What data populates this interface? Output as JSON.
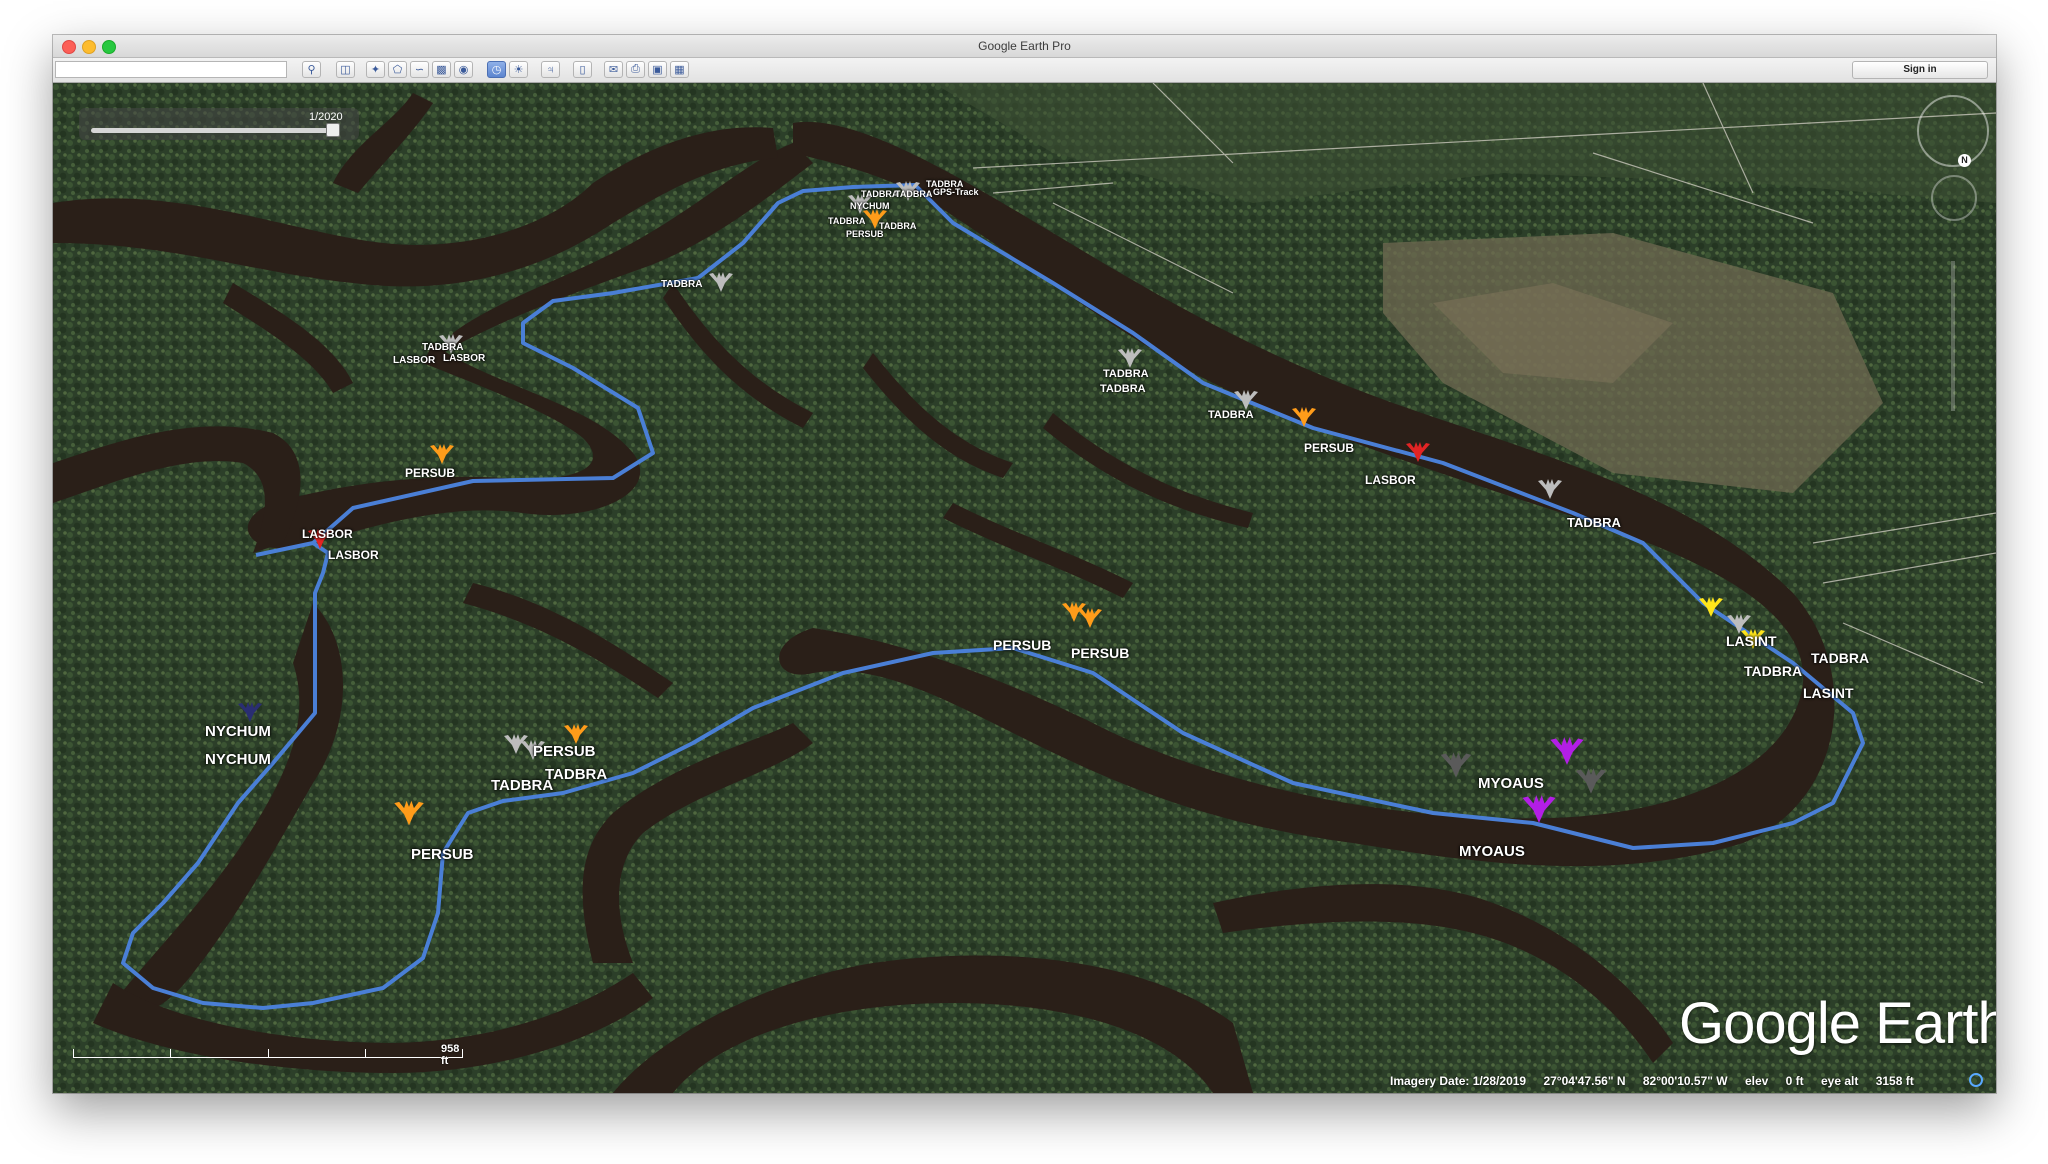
{
  "window": {
    "title": "Google Earth Pro"
  },
  "toolbar": {
    "search_value": "",
    "sign_in": "Sign in"
  },
  "time_slider": {
    "label": "1/2020"
  },
  "scale": {
    "label": "958 ft"
  },
  "compass": {
    "north_label": "N"
  },
  "logo": "Google Earth",
  "status": {
    "imagery_date": "Imagery Date: 1/28/2019",
    "latitude": "27°04'47.56\" N",
    "longitude": "82°00'10.57\" W",
    "elev": "elev",
    "elev_value": "0 ft",
    "eye_alt": "eye alt",
    "eye_alt_value": "3158 ft"
  },
  "colors": {
    "track": "#4a7fd6",
    "TADBRA": "#bdbdbd",
    "PERSUB": "#ff9c1a",
    "LASBOR": "#e32424",
    "NYCHUM": "#2a2e72",
    "MYOAUS": "#b31ee6",
    "LASINT": "#ffe51a"
  },
  "labels": {
    "gps": "GPS-Track",
    "t1": "TADBRA",
    "t2": "TADBRA",
    "t3": "TADBRA",
    "t4": "NYCHUM",
    "t5": "TADBRA",
    "t6": "PERSUB",
    "t7": "TADBRA",
    "t8": "TADBRA",
    "t9": "TADBRA",
    "t10": "LASBOR",
    "t11": "LASBOR",
    "t12": "TADBRA",
    "t13": "TADBRA",
    "t14": "TADBRA",
    "t15": "PERSUB",
    "t16": "LASBOR",
    "t17": "TADBRA",
    "t18": "PERSUB",
    "t19": "LASBOR",
    "t20": "LASBOR",
    "t21": "LASINT",
    "t22": "TADBRA",
    "t23": "TADBRA",
    "t24": "LASINT",
    "t25": "PERSUB",
    "t26": "PERSUB",
    "t27": "NYCHUM",
    "t28": "NYCHUM",
    "t29": "PERSUB",
    "t30": "TADBRA",
    "t31": "TADBRA",
    "t32": "PERSUB",
    "t33": "MYOAUS",
    "t34": "MYOAUS"
  }
}
